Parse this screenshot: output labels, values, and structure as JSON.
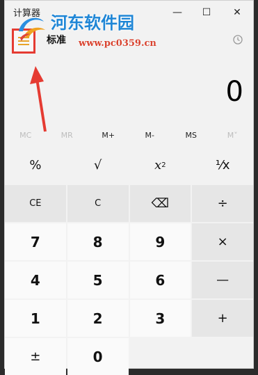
{
  "window": {
    "title": "计算器",
    "minimize_glyph": "—",
    "maximize_glyph": "☐",
    "close_glyph": "✕"
  },
  "watermark": {
    "site_name": "河东软件园",
    "url": "www.pc0359.cn"
  },
  "header": {
    "mode": "标准",
    "menu_icon": "hamburger-icon",
    "history_icon": "history-icon"
  },
  "display": {
    "value": "0"
  },
  "memory": [
    {
      "label": "MC",
      "enabled": false
    },
    {
      "label": "MR",
      "enabled": false
    },
    {
      "label": "M+",
      "enabled": true
    },
    {
      "label": "M-",
      "enabled": true
    },
    {
      "label": "MS",
      "enabled": true
    },
    {
      "label": "M˅",
      "enabled": false
    }
  ],
  "keys": {
    "percent": "%",
    "sqrt": "√",
    "square_base": "x",
    "square_exp": "2",
    "reciprocal": "¹⁄x",
    "ce": "CE",
    "c": "C",
    "backspace": "⌫",
    "divide": "÷",
    "seven": "7",
    "eight": "8",
    "nine": "9",
    "multiply": "×",
    "four": "4",
    "five": "5",
    "six": "6",
    "minus": "—",
    "one": "1",
    "two": "2",
    "three": "3",
    "plus": "+",
    "negate": "±",
    "zero": "0"
  },
  "colors": {
    "highlight_box": "#e53b32",
    "arrow": "#e53b32",
    "watermark_cn": "#1f86d6",
    "watermark_url": "#d9432f"
  }
}
